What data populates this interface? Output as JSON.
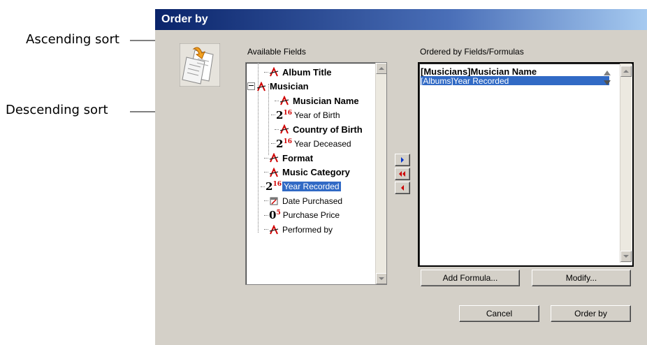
{
  "callouts": {
    "ascending": "Ascending sort",
    "descending": "Descending sort"
  },
  "dialog": {
    "title": "Order by",
    "available_label": "Available Fields",
    "ordered_label": "Ordered by Fields/Formulas",
    "tree_items": [
      {
        "label": "Album Title",
        "icon": "alpha-field-icon",
        "bold": true
      },
      {
        "label": "Musician",
        "icon": "alpha-field-icon",
        "bold": true,
        "expander": "minus"
      },
      {
        "label": "Musician Name",
        "icon": "alpha-field-icon",
        "bold": true
      },
      {
        "label": "Year of Birth",
        "icon": "integer-field-icon",
        "bold": false
      },
      {
        "label": "Country of Birth",
        "icon": "alpha-field-icon",
        "bold": true
      },
      {
        "label": "Year Deceased",
        "icon": "integer-field-icon",
        "bold": false
      },
      {
        "label": "Format",
        "icon": "alpha-field-icon",
        "bold": true
      },
      {
        "label": "Music Category",
        "icon": "alpha-field-icon",
        "bold": true
      },
      {
        "label": "Year Recorded",
        "icon": "integer-field-icon",
        "bold": false,
        "selected": true
      },
      {
        "label": "Date Purchased",
        "icon": "date-field-icon",
        "bold": false
      },
      {
        "label": "Purchase Price",
        "icon": "real-field-icon",
        "bold": false
      },
      {
        "label": "Performed by",
        "icon": "alpha-field-icon",
        "bold": false
      }
    ],
    "ordered_items": [
      {
        "label": "[Musicians]Musician Name",
        "sort": "ascending",
        "bold": true
      },
      {
        "label": "[Albums]Year Recorded",
        "sort": "descending",
        "selected": true
      }
    ],
    "buttons": {
      "add_formula": "Add Formula...",
      "modify": "Modify...",
      "cancel": "Cancel",
      "order_by": "Order by"
    },
    "integer_icon_glyph": "2",
    "integer_icon_sup": "16",
    "real_icon_glyph": "0",
    "real_icon_sup": "5"
  },
  "colors": {
    "selection": "#316ac5",
    "title_bar_start": "#0a246a",
    "title_bar_end": "#a6caf0",
    "dialog_face": "#d4d0c8",
    "alpha_icon": "#d00000"
  }
}
